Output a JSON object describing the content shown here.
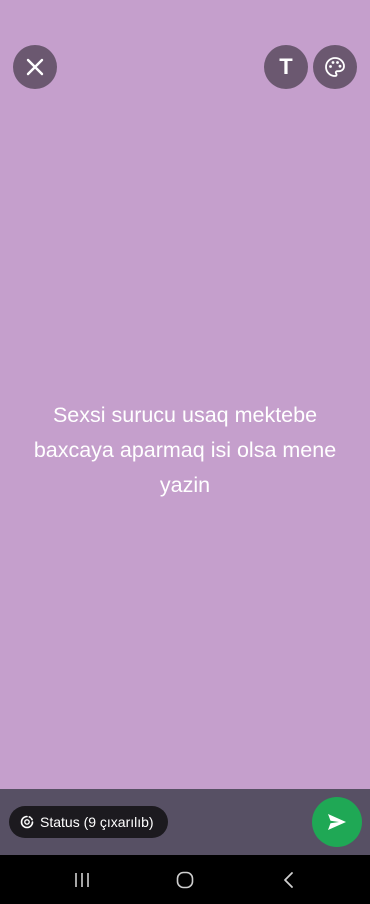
{
  "colors": {
    "background": "#c59fcc",
    "button_bg": "#6b5870",
    "bottom_bar": "#575064",
    "pill_bg": "#1c1a1f",
    "send": "#1fa855",
    "nav_bar": "#000000"
  },
  "toolbar": {
    "close_icon": "close-icon",
    "text_tool_label": "T",
    "palette_icon": "palette-icon"
  },
  "status": {
    "text": "Sexsi surucu usaq mektebe baxcaya aparmaq isi olsa mene yazin"
  },
  "footer": {
    "privacy_label": "Status (9 çıxarılıb)",
    "privacy_icon": "status-ring-icon",
    "send_icon": "send-icon"
  },
  "navigation": {
    "recent_icon": "recent-apps-icon",
    "home_icon": "home-icon",
    "back_icon": "back-icon"
  }
}
